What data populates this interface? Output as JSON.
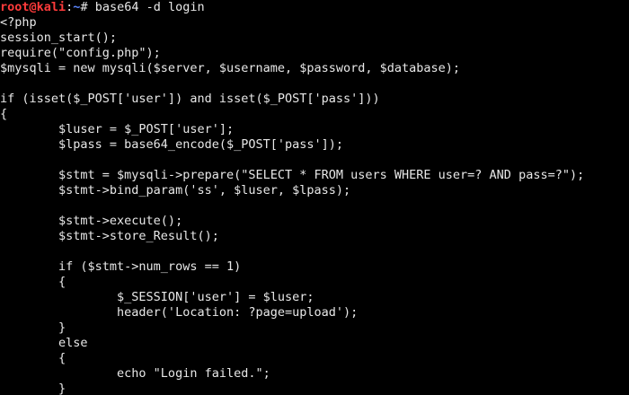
{
  "prompt": {
    "user_host": "root@kali",
    "colon": ":",
    "path": "~",
    "symbol": "#",
    "command": " base64 -d login"
  },
  "colors": {
    "background": "#000000",
    "text": "#e8e8e8",
    "prompt_user": "#ff3b3b",
    "prompt_path": "#5c86ff"
  },
  "code_lines": [
    "<?php",
    "session_start();",
    "require(\"config.php\");",
    "$mysqli = new mysqli($server, $username, $password, $database);",
    "",
    "if (isset($_POST['user']) and isset($_POST['pass']))",
    "{",
    "        $luser = $_POST['user'];",
    "        $lpass = base64_encode($_POST['pass']);",
    "",
    "        $stmt = $mysqli->prepare(\"SELECT * FROM users WHERE user=? AND pass=?\");",
    "        $stmt->bind_param('ss', $luser, $lpass);",
    "",
    "        $stmt->execute();",
    "        $stmt->store_Result();",
    "",
    "        if ($stmt->num_rows == 1)",
    "        {",
    "                $_SESSION['user'] = $luser;",
    "                header('Location: ?page=upload');",
    "        }",
    "        else",
    "        {",
    "                echo \"Login failed.\";",
    "        }"
  ]
}
